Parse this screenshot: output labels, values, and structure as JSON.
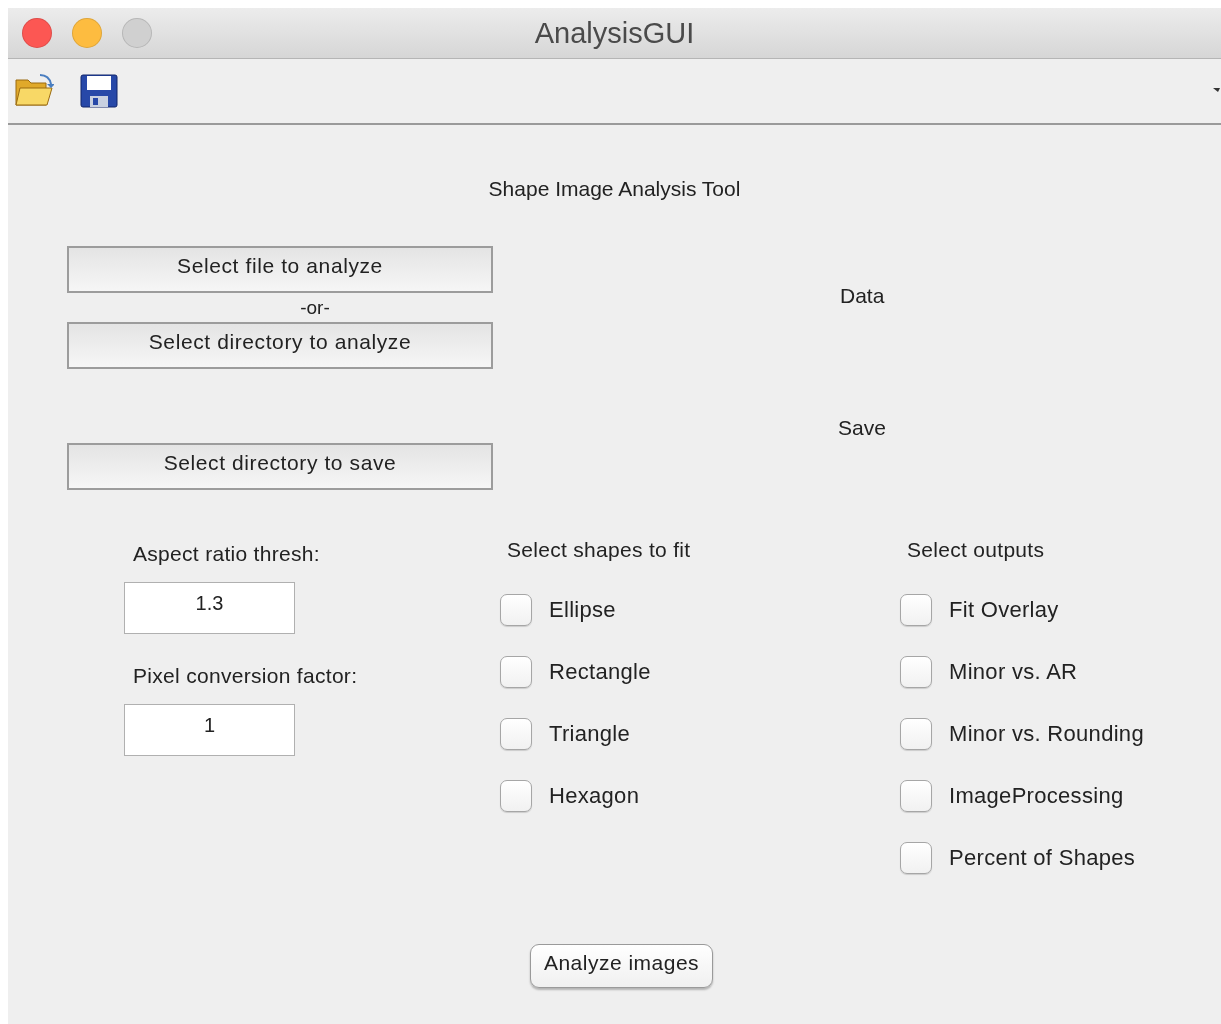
{
  "window": {
    "title": "AnalysisGUI"
  },
  "heading": "Shape Image Analysis Tool",
  "source_buttons": [
    "Select file to analyze",
    "Select directory to analyze"
  ],
  "separator": "-or-",
  "save_button": "Select directory to save",
  "data_label": "Data",
  "save_label": "Save",
  "fields": [
    {
      "label": "Aspect ratio thresh:",
      "value": "1.3"
    },
    {
      "label": "Pixel conversion factor:",
      "value": "1"
    }
  ],
  "shapes": {
    "title": "Select shapes to fit",
    "options": [
      {
        "label": "Ellipse",
        "checked": false
      },
      {
        "label": "Rectangle",
        "checked": false
      },
      {
        "label": "Triangle",
        "checked": false
      },
      {
        "label": "Hexagon",
        "checked": false
      }
    ]
  },
  "outputs": {
    "title": "Select outputs",
    "options": [
      {
        "label": "Fit Overlay",
        "checked": false
      },
      {
        "label": "Minor vs. AR",
        "checked": false
      },
      {
        "label": "Minor vs. Rounding",
        "checked": false
      },
      {
        "label": "ImageProcessing",
        "checked": false
      },
      {
        "label": "Percent of Shapes",
        "checked": false
      }
    ]
  },
  "analyze_button": "Analyze images"
}
